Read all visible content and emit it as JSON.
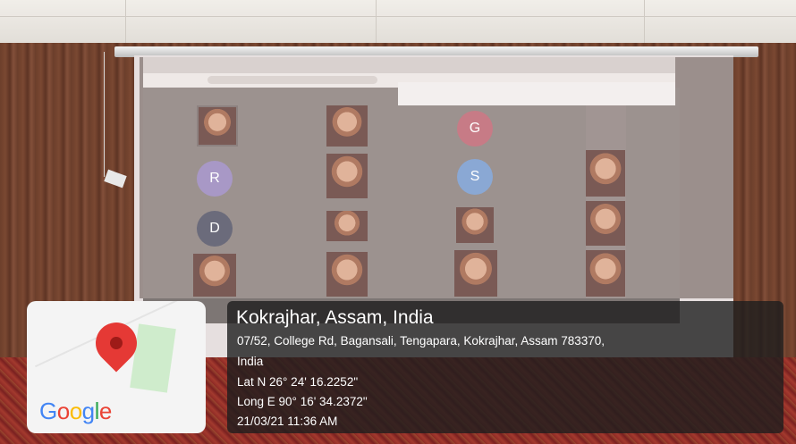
{
  "location": {
    "title": "Kokrajhar, Assam, India",
    "address_line1": "07/52, College Rd, Bagansali, Tengapara, Kokrajhar, Assam 783370,",
    "address_line2": "India",
    "latitude": "Lat N 26° 24' 16.2252\"",
    "longitude": "Long E 90° 16' 34.2372\"",
    "timestamp": "21/03/21 11:36 AM"
  },
  "map_card": {
    "brand": {
      "G": "G",
      "o1": "o",
      "o2": "o",
      "g": "g",
      "l": "l",
      "e": "e"
    },
    "brand_colors": {
      "G": "#4285F4",
      "o1": "#EA4335",
      "o2": "#FBBC05",
      "g": "#4285F4",
      "l": "#34A853",
      "e": "#EA4335"
    },
    "pin_color": "#e53935"
  },
  "projected_call": {
    "tiles_letters": [
      "G",
      "R",
      "S",
      "D"
    ]
  }
}
